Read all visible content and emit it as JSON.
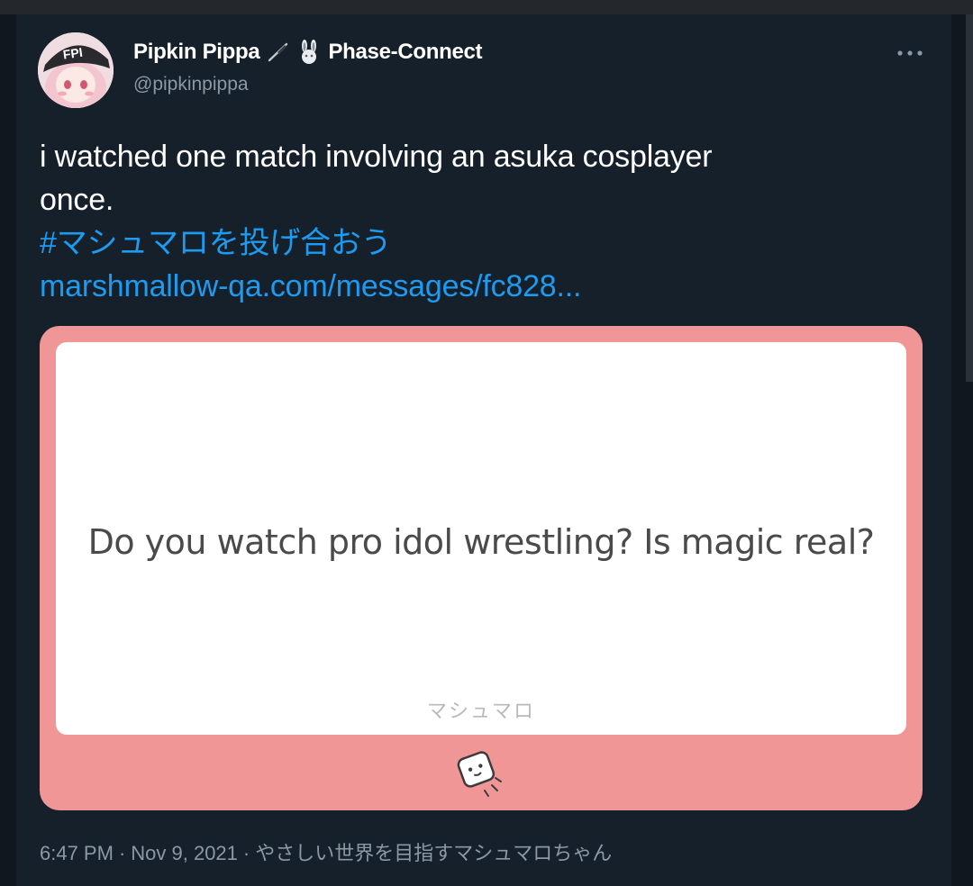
{
  "tweet": {
    "author": {
      "display_name": "Pipkin Pippa",
      "affiliation": "Phase-Connect",
      "handle": "@pipkinpippa"
    },
    "text_lines": [
      "i watched one match involving an asuka cosplayer",
      "once."
    ],
    "hashtag": "#マシュマロを投げ合おう",
    "link": "marshmallow-qa.com/messages/fc828...",
    "card": {
      "question": "Do you watch pro idol wrestling? Is magic real?",
      "brand": "マシュマロ",
      "background_color": "#f19697"
    },
    "meta": {
      "time": "6:47 PM",
      "date": "Nov 9, 2021",
      "source": "やさしい世界を目指すマシュマロちゃん",
      "separator": "·"
    },
    "icons": {
      "more": "more-horizontal-icon",
      "name_glyph_1": "feather-icon",
      "name_glyph_2": "bunny-icon",
      "card_mascot": "marshmallow-mascot-icon"
    }
  },
  "colors": {
    "background": "#15202b",
    "text": "#ffffff",
    "muted": "#8b98a5",
    "link": "#1d9bf0"
  }
}
